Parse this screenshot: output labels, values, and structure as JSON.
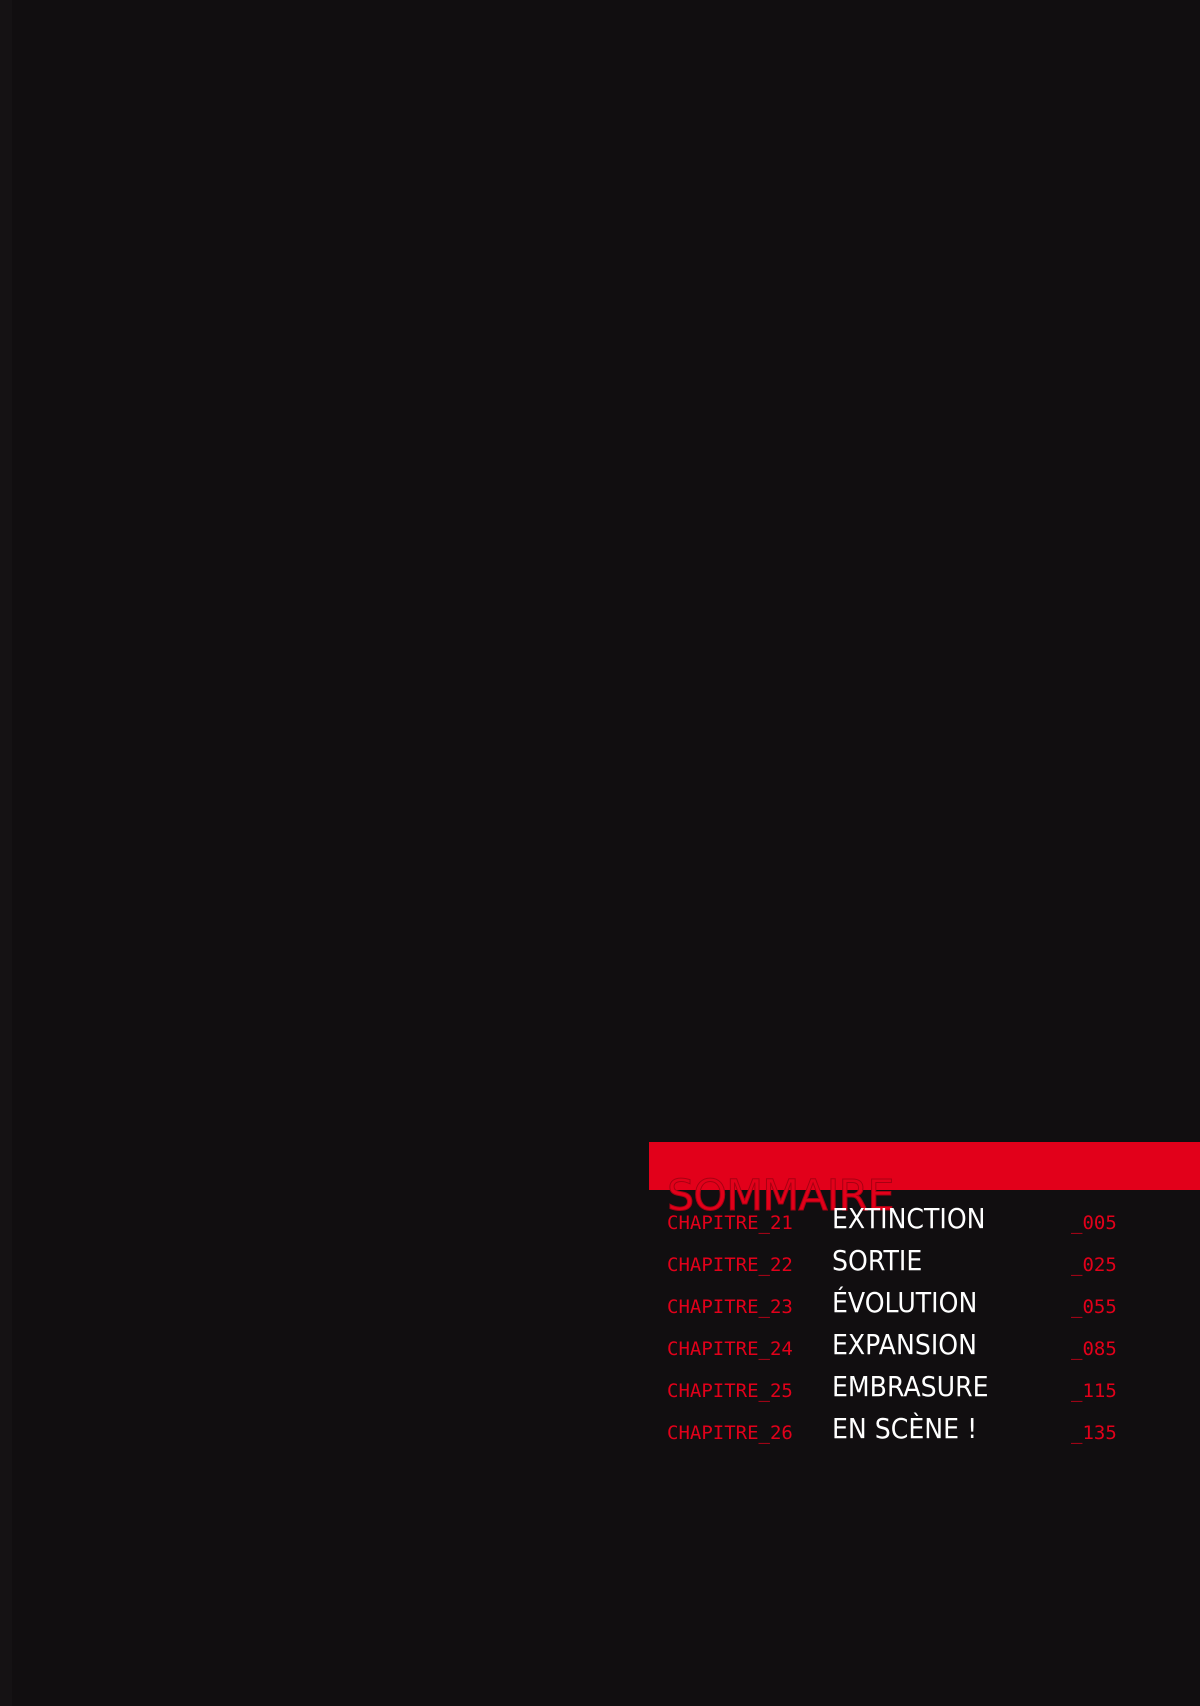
{
  "colors": {
    "background": "#110e10",
    "accent": "#e2001a",
    "title_text": "#ffffff"
  },
  "toc": {
    "heading": "SOMMAIRE",
    "entries": [
      {
        "chapter": "CHAPITRE_21",
        "title": "EXTINCTION",
        "page": "_005"
      },
      {
        "chapter": "CHAPITRE_22",
        "title": "SORTIE",
        "page": "_025"
      },
      {
        "chapter": "CHAPITRE_23",
        "title": "ÉVOLUTION",
        "page": "_055"
      },
      {
        "chapter": "CHAPITRE_24",
        "title": "EXPANSION",
        "page": "_085"
      },
      {
        "chapter": "CHAPITRE_25",
        "title": "EMBRASURE",
        "page": "_115"
      },
      {
        "chapter": "CHAPITRE_26",
        "title": "EN SCÈNE !",
        "page": "_135"
      }
    ]
  }
}
